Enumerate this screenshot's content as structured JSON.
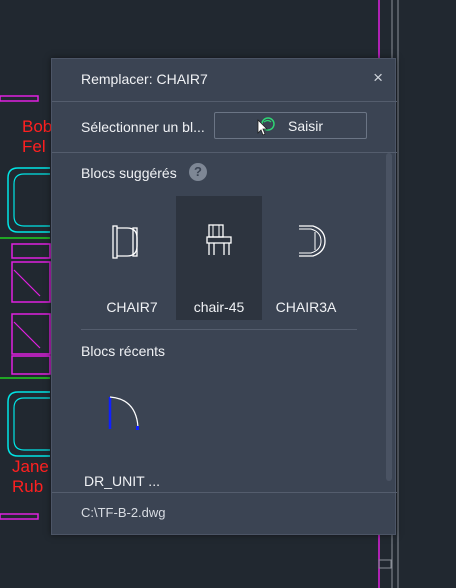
{
  "background_color": "#212830",
  "cad": {
    "labels": [
      "Bob",
      "Fel",
      "Jane",
      "Rub"
    ],
    "colors": {
      "cyan": "#00e5e5",
      "magenta": "#e020e0",
      "green": "#20d020",
      "red": "#ff2020",
      "blue": "#1020ff"
    }
  },
  "dialog": {
    "title": "Remplacer: CHAIR7",
    "close_glyph": "×",
    "select_label": "Sélectionner un bl...",
    "pick_button_label": "Saisir",
    "pick_icon": "pick-cursor-icon",
    "suggested_header": "Blocs suggérés",
    "help_glyph": "?",
    "suggested_blocks": [
      {
        "label": "CHAIR7",
        "icon": "chair7-block-icon",
        "selected": false
      },
      {
        "label": "chair-45",
        "icon": "chair-45-block-icon",
        "selected": true
      },
      {
        "label": "CHAIR3A",
        "icon": "chair3a-block-icon",
        "selected": false
      }
    ],
    "recent_header": "Blocs récents",
    "recent_blocks": [
      {
        "label": "DR_UNIT ...",
        "icon": "door-unit-block-icon"
      }
    ],
    "footer_path": "C:\\TF-B-2.dwg"
  },
  "palette_colors": {
    "panel_bg": "#3b4453",
    "selected_bg": "#2d343f",
    "text": "#f0f2f5",
    "accent_green": "#2ed573"
  }
}
